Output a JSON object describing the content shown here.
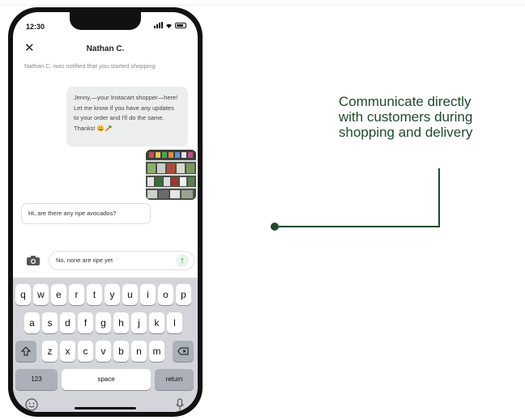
{
  "status": {
    "time": "12:30"
  },
  "chat": {
    "contact_name": "Nathan C.",
    "notice": "Nathan C. was notified that you started shopping",
    "outgoing_message": "Jenny,—your Instacart shopper—here! Let me know if you have any updates to your order and I'll do the same. Thanks! 😀🥕",
    "incoming_message": "Hi, are there any ripe avocados?",
    "input_value": "No, none are ripe yet",
    "send_icon": "arrow-up-icon",
    "camera_icon": "camera-icon",
    "close_icon": "close-icon"
  },
  "keyboard": {
    "row1": [
      "q",
      "w",
      "e",
      "r",
      "t",
      "y",
      "u",
      "i",
      "o",
      "p"
    ],
    "row2": [
      "a",
      "s",
      "d",
      "f",
      "g",
      "h",
      "j",
      "k",
      "l"
    ],
    "row3": [
      "z",
      "x",
      "c",
      "v",
      "b",
      "n",
      "m"
    ],
    "numbers_label": "123",
    "space_label": "space",
    "return_label": "return",
    "shift_icon": "shift-icon",
    "delete_icon": "backspace-icon",
    "emoji_icon": "emoji-icon",
    "mic_icon": "microphone-icon"
  },
  "caption": {
    "line1": "Communicate directly",
    "line2": "with customers during",
    "line3": "shopping and delivery"
  },
  "colors": {
    "accent_green": "#1f4a2b",
    "send_green": "#1b8a3a"
  }
}
